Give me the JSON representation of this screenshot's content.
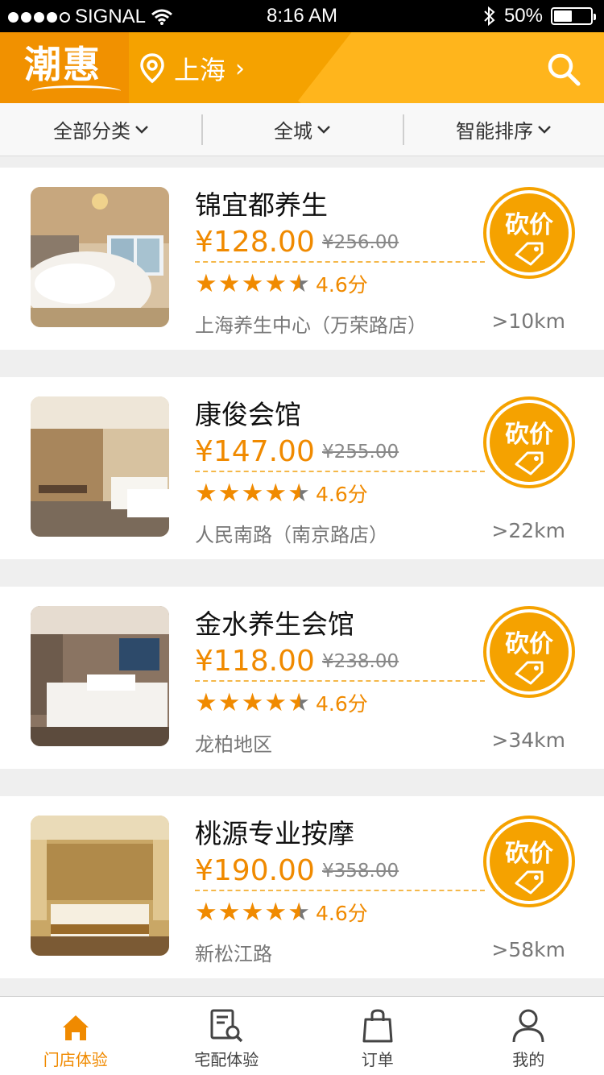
{
  "status_bar": {
    "carrier": "SIGNAL",
    "time": "8:16 AM",
    "battery": "50%",
    "battery_level": 0.5
  },
  "header": {
    "logo": "潮惠",
    "city": "上海",
    "city_chevron": "›"
  },
  "filters": [
    {
      "label": "全部分类",
      "caret": "⌄"
    },
    {
      "label": "全城",
      "caret": "⌄"
    },
    {
      "label": "智能排序",
      "caret": "⌄"
    }
  ],
  "bargain_label": "砍价",
  "colors": {
    "accent": "#f5a200",
    "price": "#f08a00",
    "header_dark": "#f19100"
  },
  "stores": [
    {
      "name": "锦宜都养生",
      "price": "¥128.00",
      "original_price": "¥256.00",
      "rating": 4.6,
      "score": "4.6分",
      "address": "上海养生中心（万荣路店）",
      "distance": ">10km"
    },
    {
      "name": "康俊会馆",
      "price": "¥147.00",
      "original_price": "¥255.00",
      "rating": 4.6,
      "score": "4.6分",
      "address": "人民南路（南京路店）",
      "distance": ">22km"
    },
    {
      "name": "金水养生会馆",
      "price": "¥118.00",
      "original_price": "¥238.00",
      "rating": 4.6,
      "score": "4.6分",
      "address": "龙柏地区",
      "distance": ">34km"
    },
    {
      "name": "桃源专业按摩",
      "price": "¥190.00",
      "original_price": "¥358.00",
      "rating": 4.6,
      "score": "4.6分",
      "address": "新松江路",
      "distance": ">58km"
    }
  ],
  "tabs": [
    {
      "label": "门店体验",
      "icon": "home-icon",
      "active": true
    },
    {
      "label": "宅配体验",
      "icon": "document-search-icon",
      "active": false
    },
    {
      "label": "订单",
      "icon": "shopping-bag-icon",
      "active": false
    },
    {
      "label": "我的",
      "icon": "user-icon",
      "active": false
    }
  ]
}
